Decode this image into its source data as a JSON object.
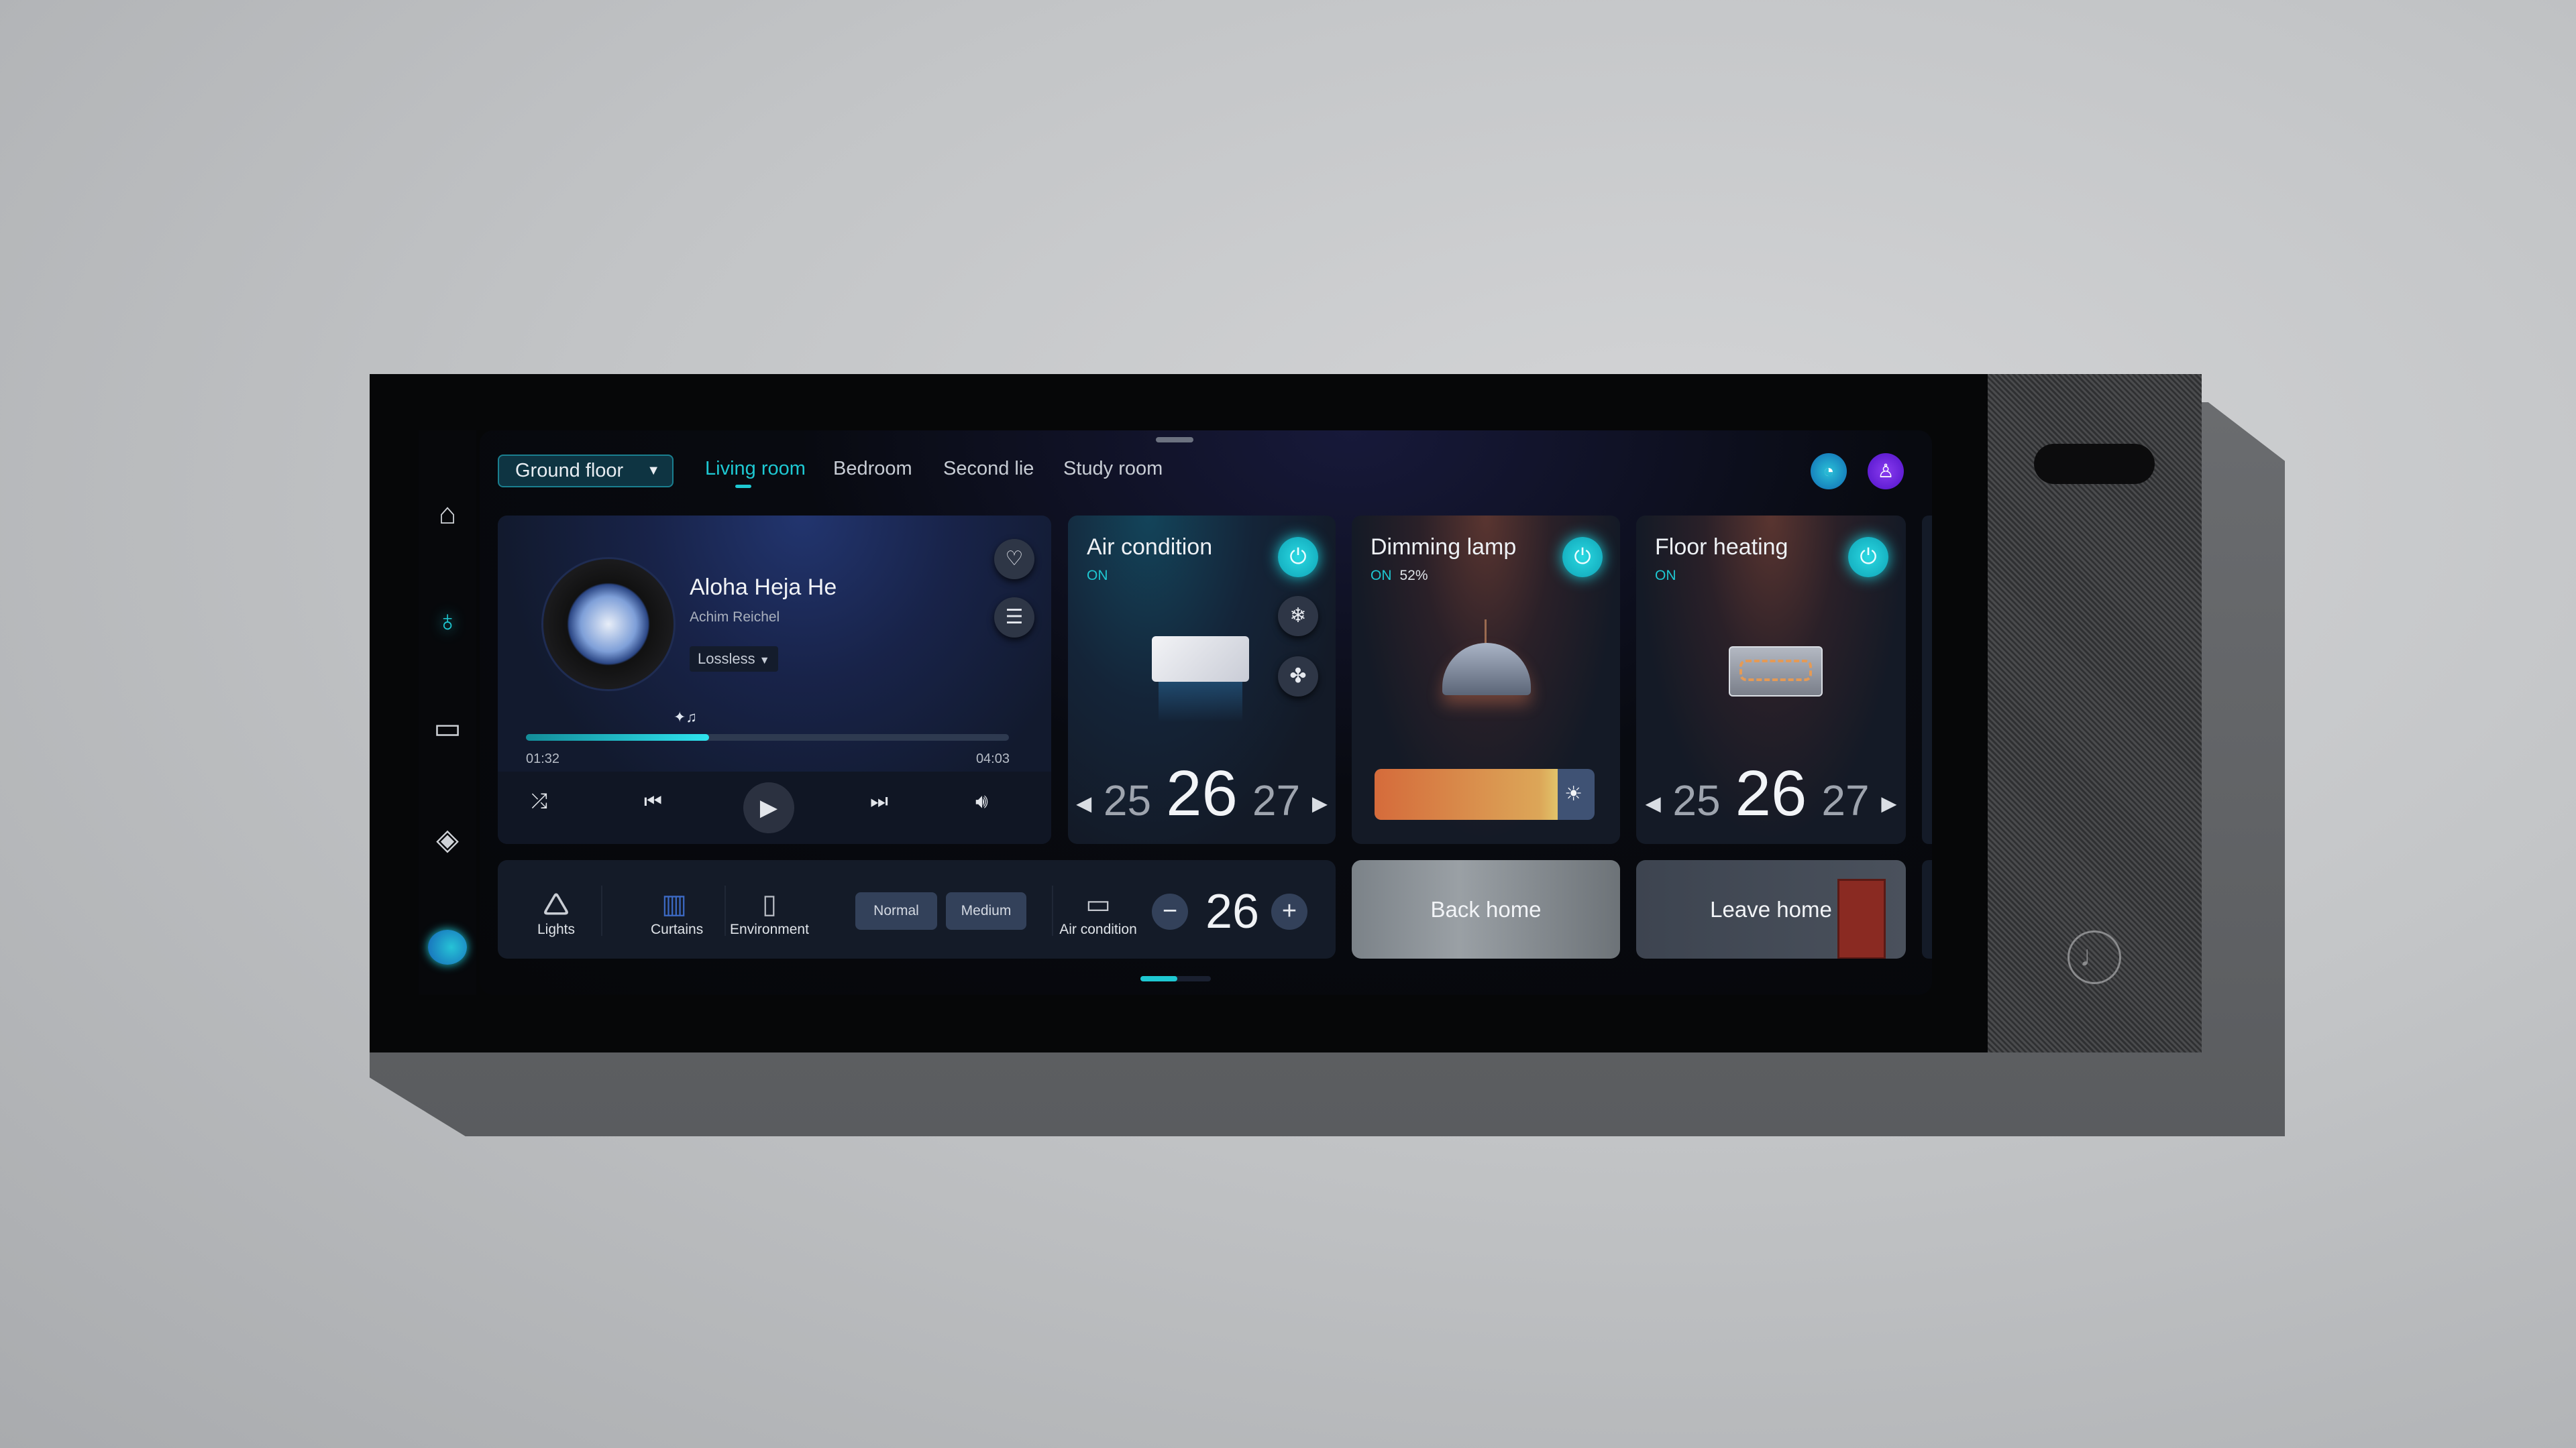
{
  "header": {
    "floor_selector": "Ground floor",
    "tabs": [
      {
        "label": "Living room",
        "active": true
      },
      {
        "label": "Bedroom"
      },
      {
        "label": "Second lie"
      },
      {
        "label": "Study room"
      }
    ]
  },
  "sidebar": {
    "items": [
      "home-icon",
      "bulb-icon",
      "message-icon",
      "layers-icon",
      "assistant-orb-icon"
    ],
    "active": 1
  },
  "music": {
    "title": "Aloha Heja He",
    "artist": "Achim Reichel",
    "quality": "Lossless",
    "elapsed": "01:32",
    "duration": "04:03",
    "progress_percent": 37.9
  },
  "devices": [
    {
      "title": "Air condition",
      "status": "ON",
      "temp_prev": "25",
      "temp": "26",
      "temp_next": "27"
    },
    {
      "title": "Dimming lamp",
      "status": "ON",
      "level": "52%",
      "level_value": 52
    },
    {
      "title": "Floor heating",
      "status": "ON",
      "temp_prev": "25",
      "temp": "26",
      "temp_next": "27"
    }
  ],
  "quickbar": {
    "lights": "Lights",
    "curtains": "Curtains",
    "environment": "Environment",
    "mode1": "Normal",
    "mode2": "Medium",
    "ac_label": "Air condition",
    "ac_temp": "26",
    "minus": "−",
    "plus": "+"
  },
  "scenes": {
    "back_home": "Back home",
    "leave_home": "Leave home"
  },
  "pager": {
    "pages": 2,
    "active": 1
  },
  "colors": {
    "accent": "#1ec8d2",
    "background": "#06070a",
    "card": "#141b28"
  }
}
